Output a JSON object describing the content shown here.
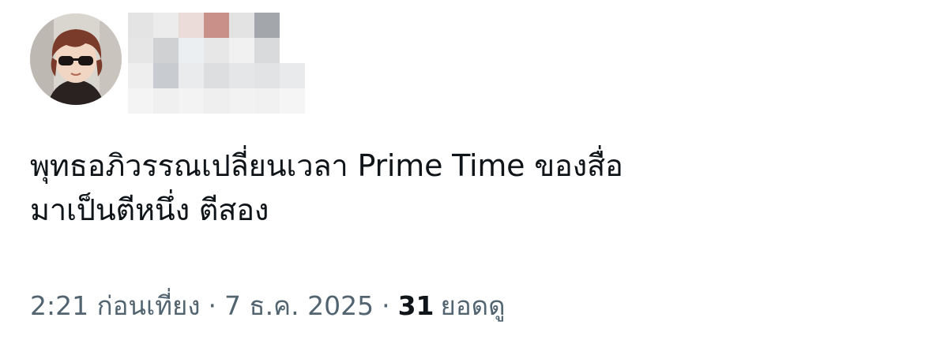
{
  "tweet": {
    "avatar_icon": "user-avatar-icon",
    "text_lines": [
      "พุทธอภิวรรณเปลี่ยนเวลา Prime Time ของสื่อ",
      "มาเป็นตีหนึ่ง ตีสอง"
    ],
    "time": "2:21 ก่อนเที่ยง",
    "separator": "·",
    "date": "7 ธ.ค. 2025",
    "views_count": "31",
    "views_label": "ยอดดู"
  },
  "colors": {
    "text_primary": "#0f1419",
    "text_secondary": "#536471",
    "background": "#ffffff"
  }
}
